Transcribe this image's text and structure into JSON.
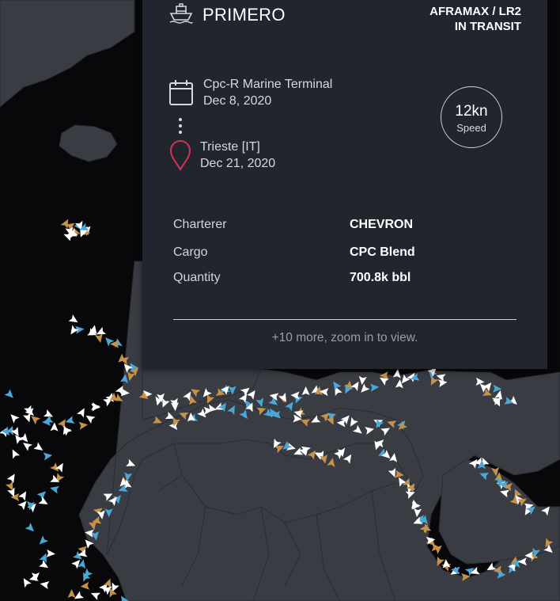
{
  "vessel": {
    "name": "PRIMERO",
    "class": "AFRAMAX / LR2",
    "status": "IN TRANSIT"
  },
  "route": {
    "origin_name": "Cpc-R Marine Terminal",
    "origin_date": "Dec 8, 2020",
    "destination_name": "Trieste [IT]",
    "destination_date": "Dec 21, 2020"
  },
  "speed": {
    "value": "12kn",
    "label": "Speed"
  },
  "details": [
    {
      "label": "Charterer",
      "value": "CHEVRON"
    },
    {
      "label": "Cargo",
      "value": "CPC Blend"
    },
    {
      "label": "Quantity",
      "value": "700.8k bbl"
    }
  ],
  "footer": {
    "more_text": "+10 more, zoom in to view."
  },
  "icons": {
    "vessel": "ship-icon",
    "origin": "calendar-icon",
    "route": "route-dots-icon",
    "destination": "map-pin-icon"
  },
  "colors": {
    "panel_bg": "#23252e",
    "water": "#08080a",
    "land": "#3a3c44",
    "marker_white": "#ffffff",
    "marker_blue": "#4aa8d8",
    "marker_gold": "#c8914a",
    "pin": "#d0325a"
  }
}
